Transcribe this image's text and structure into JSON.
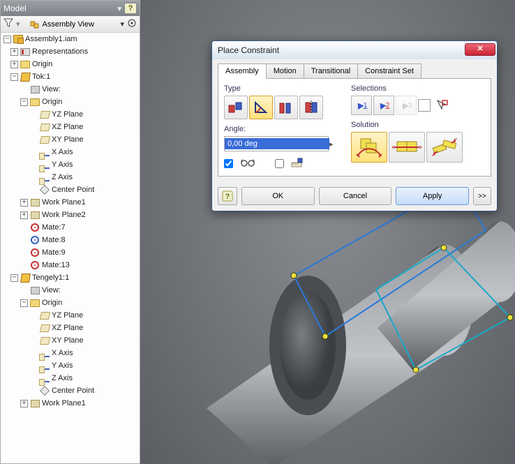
{
  "browser": {
    "title": "Model",
    "view_label": "Assembly View",
    "root": "Assembly1.iam",
    "items": {
      "representations": "Representations",
      "origin": "Origin",
      "tok": "Tok:1",
      "view": "View:",
      "yz": "YZ Plane",
      "xz": "XZ Plane",
      "xy": "XY Plane",
      "x": "X Axis",
      "y": "Y Axis",
      "z": "Z Axis",
      "cp": "Center Point",
      "wp1": "Work Plane1",
      "wp2": "Work Plane2",
      "m7": "Mate:7",
      "m8": "Mate:8",
      "m9": "Mate:9",
      "m13": "Mate:13",
      "tengely": "Tengely1:1"
    }
  },
  "dialog": {
    "title": "Place Constraint",
    "tabs": {
      "assembly": "Assembly",
      "motion": "Motion",
      "transitional": "Transitional",
      "cset": "Constraint Set"
    },
    "type_label": "Type",
    "selections_label": "Selections",
    "angle_label": "Angle:",
    "angle_value": "0,00 deg",
    "solution_label": "Solution",
    "ok": "OK",
    "cancel": "Cancel",
    "apply": "Apply",
    "expand": ">>",
    "sel1": "1",
    "sel2": "2",
    "sel3": "3"
  }
}
